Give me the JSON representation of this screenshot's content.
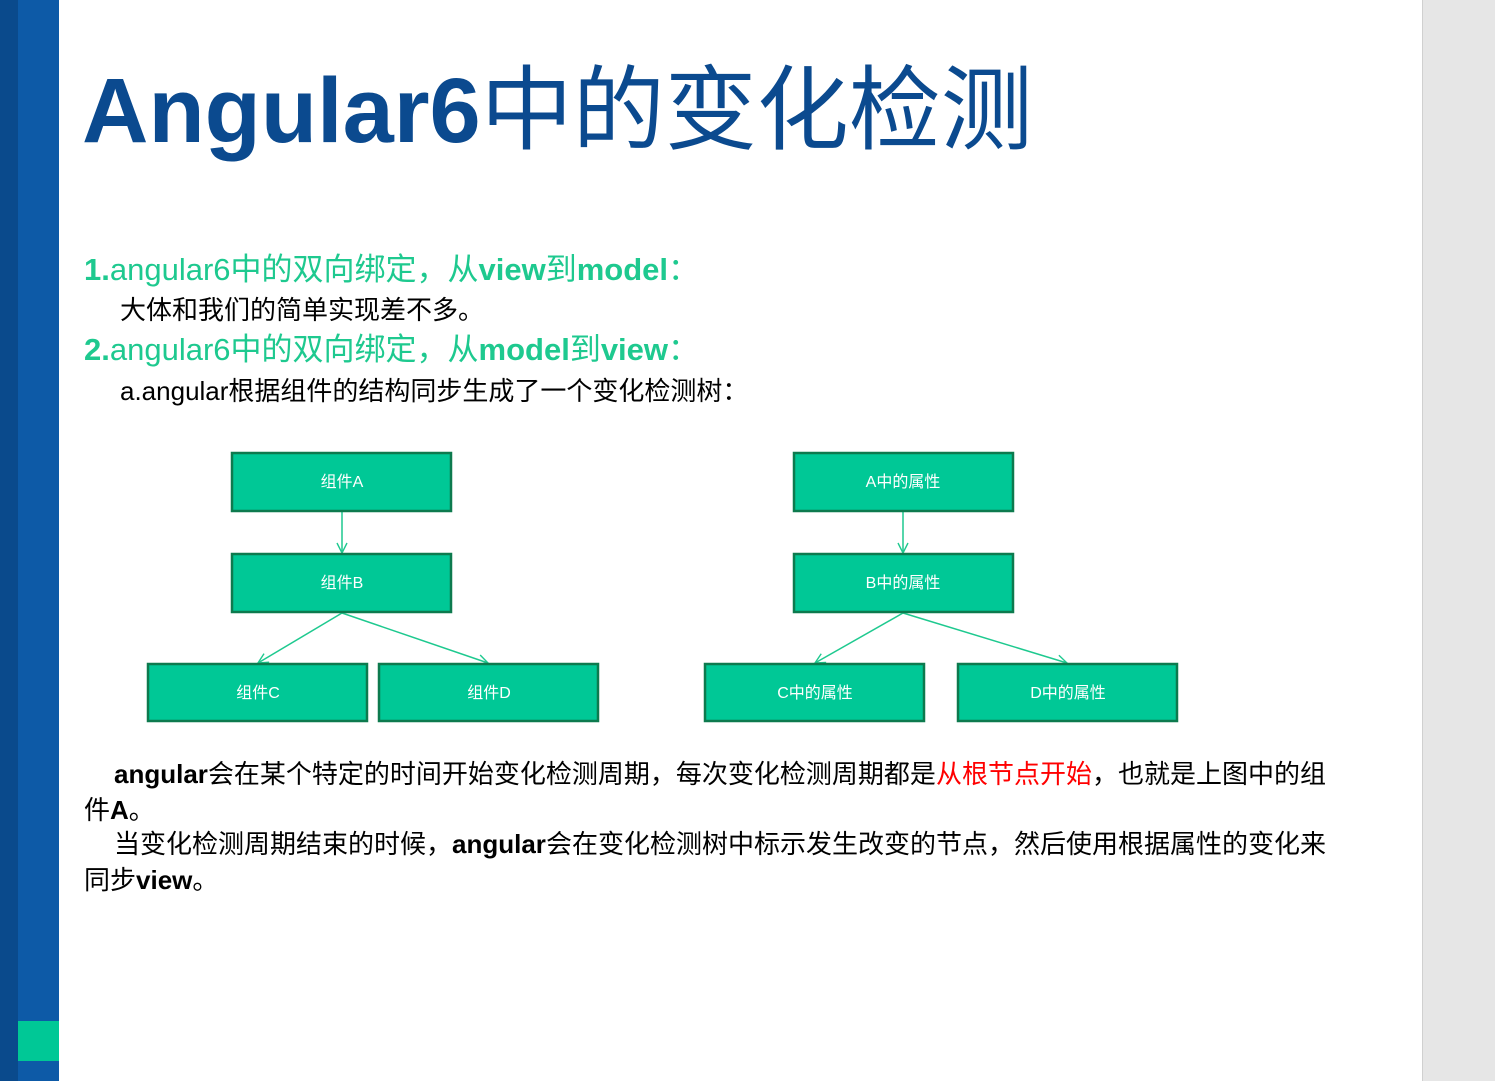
{
  "slide": {
    "title": {
      "latin": "Angular6",
      "cjk": "中的变化检测"
    },
    "heading1": {
      "num": "1.",
      "pre": "angular6中的双向绑定，从",
      "b1": "view",
      "mid": "到",
      "b2": "model",
      "end": "："
    },
    "line1": "大体和我们的简单实现差不多。",
    "heading2": {
      "num": "2.",
      "pre": "angular6中的双向绑定，从",
      "b1": "model",
      "mid": "到",
      "b2": "view",
      "end": "："
    },
    "line2": "a.angular根据组件的结构同步生成了一个变化检测树：",
    "para1": {
      "b1": "angular",
      "t1": "会在某个特定的时间开始变化检测周期，每次变化检测周期都是",
      "red": "从根节点开始",
      "t2": "，也就是上图中的组件",
      "b2": "A",
      "t3": "。"
    },
    "para2": {
      "t1": "当变化检测周期结束的时候，",
      "b1": "angular",
      "t2": "会在变化检测树中标示发生改变的节点，然后使用根据属性的变化来同步",
      "b2": "view",
      "t3": "。"
    }
  },
  "diagram": {
    "left_tree": {
      "root": "组件A",
      "child": "组件B",
      "leaf_left": "组件C",
      "leaf_right": "组件D"
    },
    "right_tree": {
      "root": "A中的属性",
      "child": "B中的属性",
      "leaf_left": "C中的属性",
      "leaf_right": "D中的属性"
    }
  },
  "colors": {
    "title": "#0b4a8f",
    "heading": "#1ec98f",
    "node_fill": "#00c896",
    "node_border": "#0d7a4e",
    "highlight": "#ff0000",
    "sidebar": "#0d5aa7",
    "sidebar_accent": "#00c896"
  }
}
